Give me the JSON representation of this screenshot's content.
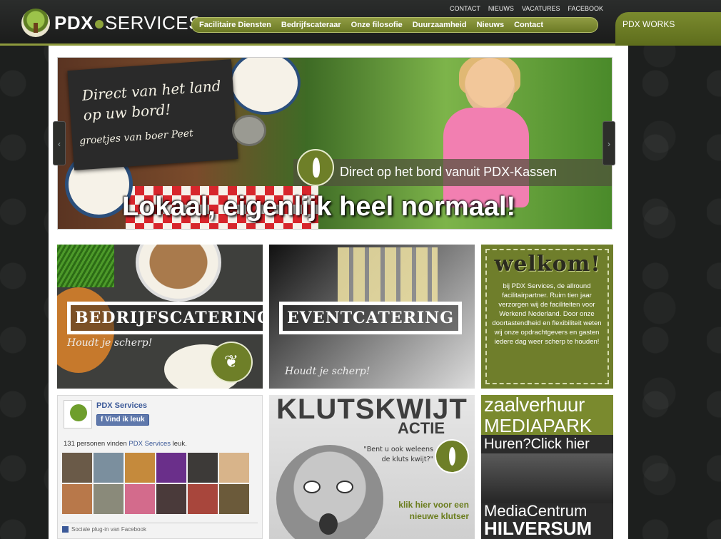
{
  "header": {
    "logo_bold": "PDX",
    "logo_light": "SERVICES",
    "top_links": [
      "CONTACT",
      "NIEUWS",
      "VACATURES",
      "FACEBOOK"
    ],
    "main_nav": [
      "Facilitaire Diensten",
      "Bedrijfscateraar",
      "Onze filosofie",
      "Duurzaamheid",
      "Nieuws",
      "Contact"
    ],
    "works_tab": "PDX WORKS"
  },
  "slider": {
    "board_line1": "Direct van het land op uw bord!",
    "board_line2": "groetjes van boer Peet",
    "caption": "Direct op het bord vanuit PDX-Kassen",
    "headline": "Lokaal, eigenlijk heel normaal!",
    "prev_arrow": "‹",
    "next_arrow": "›"
  },
  "tiles": {
    "catering": {
      "banner": "BEDRIJFSCATERING",
      "tagline": "Houdt je scherp!"
    },
    "event": {
      "banner": "EVENTCATERING",
      "tagline": "Houdt je scherp!"
    },
    "welcome": {
      "title": "welkom!",
      "body": "bij PDX Services, de allround facilitairpartner. Ruim tien jaar verzorgen wij de faciliteiten voor Werkend Nederland. Door onze doortastendheid en flexibiliteit weten wij onze opdrachtgevers en gasten iedere dag weer scherp te houden!"
    },
    "facebook": {
      "name": "PDX Services",
      "like_button": "Vind ik leuk",
      "count_prefix": "131 personen vinden ",
      "count_link": "PDX Services",
      "count_suffix": " leuk.",
      "footer": "Sociale plug-in van Facebook"
    },
    "kluts": {
      "title": "KLUTSKWIJT",
      "subtitle": "ACTIE",
      "question": "\"Bent u ook weleens de kluts kwijt?\"",
      "cta": "klik hier voor een nieuwe klutser"
    },
    "zaal": {
      "line1": "zaalverhuur",
      "line2": "MEDIAPARK",
      "line3": "Huren?Click hier",
      "line4": "MediaCentrum",
      "line5": "HILVERSUM"
    }
  },
  "colors": {
    "accent_green": "#7a8a2e",
    "facebook_blue": "#3b5998"
  }
}
